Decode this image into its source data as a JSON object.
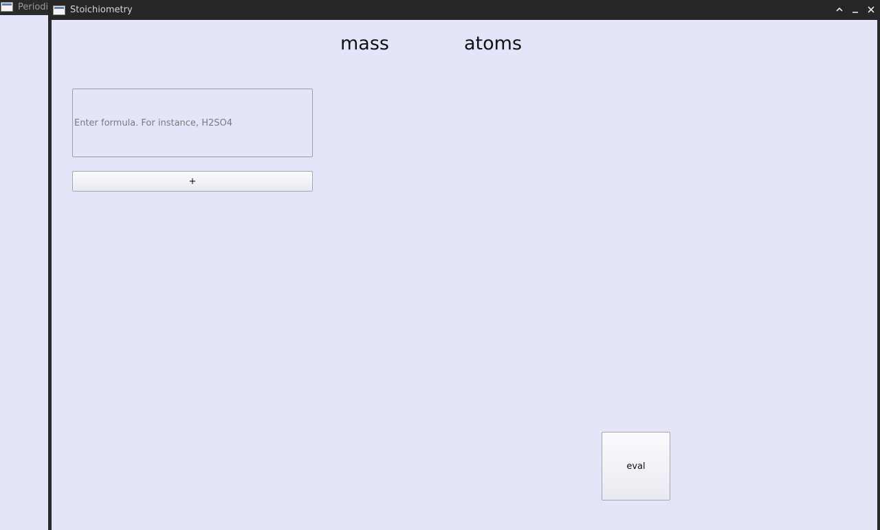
{
  "background_window": {
    "title": "Periodi"
  },
  "window": {
    "title": "Stoichiometry",
    "controls": {
      "maximize_icon": "chevron-up-icon",
      "minimize_icon": "minimize-icon",
      "close_icon": "close-icon"
    }
  },
  "headings": {
    "mass": "mass",
    "atoms": "atoms"
  },
  "formula_input": {
    "value": "",
    "placeholder": "Enter formula. For instance, H2SO4"
  },
  "buttons": {
    "add_label": "+",
    "eval_label": "eval"
  },
  "colors": {
    "background": "#e4e5f8",
    "titlebar": "#262626"
  }
}
